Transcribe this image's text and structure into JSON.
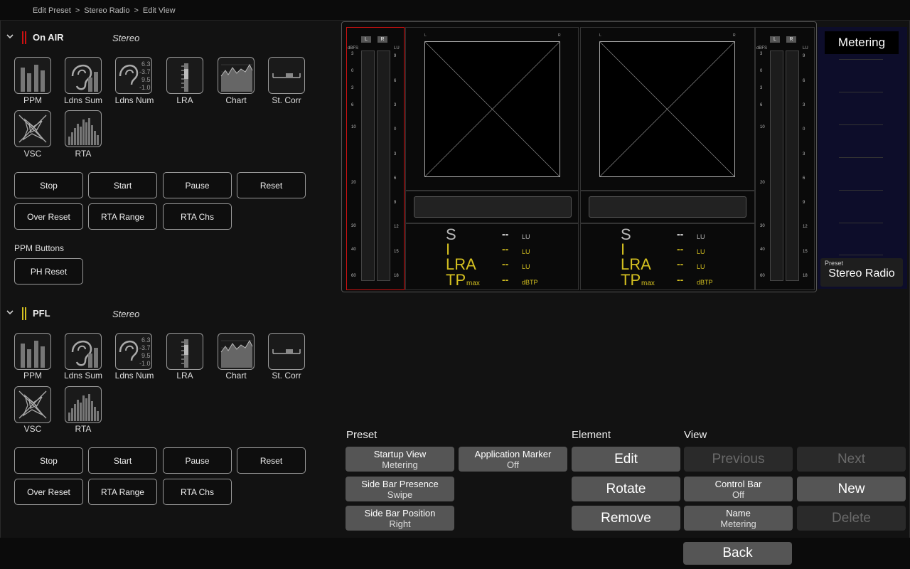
{
  "breadcrumb": [
    "Edit Preset",
    ">",
    "Stereo Radio",
    ">",
    "Edit View"
  ],
  "groups": [
    {
      "title": "On AIR",
      "mode": "Stereo",
      "bar_color": "#cc1111",
      "tiles": [
        "PPM",
        "Ldns Sum",
        "Ldns Num",
        "LRA",
        "Chart",
        "St. Corr",
        "VSC",
        "RTA"
      ],
      "buttons": [
        "Stop",
        "Start",
        "Pause",
        "Reset",
        "Over Reset",
        "RTA Range",
        "RTA Chs"
      ],
      "ppm_buttons_label": "PPM Buttons",
      "ppm_buttons": [
        "PH Reset"
      ]
    },
    {
      "title": "PFL",
      "mode": "Stereo",
      "bar_color": "#d4c020",
      "tiles": [
        "PPM",
        "Ldns Sum",
        "Ldns Num",
        "LRA",
        "Chart",
        "St. Corr",
        "VSC",
        "RTA"
      ],
      "buttons": [
        "Stop",
        "Start",
        "Pause",
        "Reset",
        "Over Reset",
        "RTA Range",
        "RTA Chs"
      ]
    }
  ],
  "ldns_num_values": [
    "6.3",
    "-3.7",
    "9.5",
    "-1.0"
  ],
  "preview": {
    "ppm_header": [
      "L",
      "R"
    ],
    "ppm_unit_left": "dBFS",
    "ppm_unit_right": "LU",
    "left_scale": [
      "3",
      "0",
      "3",
      "6",
      "10",
      "20",
      "30",
      "40",
      "60"
    ],
    "right_scale": [
      "9",
      "6",
      "3",
      "0",
      "3",
      "6",
      "9",
      "12",
      "15",
      "18"
    ],
    "vector_labels": [
      "L",
      "R"
    ],
    "loudness": [
      {
        "label": "S",
        "value": "--",
        "unit": "LU",
        "color": "#bbbbbb"
      },
      {
        "label": "I",
        "value": "--",
        "unit": "LU",
        "color": "#d4c020"
      },
      {
        "label": "LRA",
        "value": "--",
        "unit": "LU",
        "color": "#d4c020"
      },
      {
        "label": "TP",
        "sub": "max",
        "value": "--",
        "unit": "dBTP",
        "color": "#d4c020"
      }
    ]
  },
  "sidebar": {
    "title": "Metering",
    "preset_caption": "Preset",
    "preset_value": "Stereo Radio"
  },
  "controls": {
    "preset_title": "Preset",
    "element_title": "Element",
    "view_title": "View",
    "startup_view": {
      "label": "Startup View",
      "value": "Metering"
    },
    "application_marker": {
      "label": "Application Marker",
      "value": "Off"
    },
    "side_bar_presence": {
      "label": "Side Bar Presence",
      "value": "Swipe"
    },
    "side_bar_position": {
      "label": "Side Bar Position",
      "value": "Right"
    },
    "edit": "Edit",
    "rotate": "Rotate",
    "remove": "Remove",
    "previous": "Previous",
    "next": "Next",
    "control_bar": {
      "label": "Control Bar",
      "value": "Off"
    },
    "new": "New",
    "name": {
      "label": "Name",
      "value": "Metering"
    },
    "delete": "Delete",
    "back": "Back"
  }
}
